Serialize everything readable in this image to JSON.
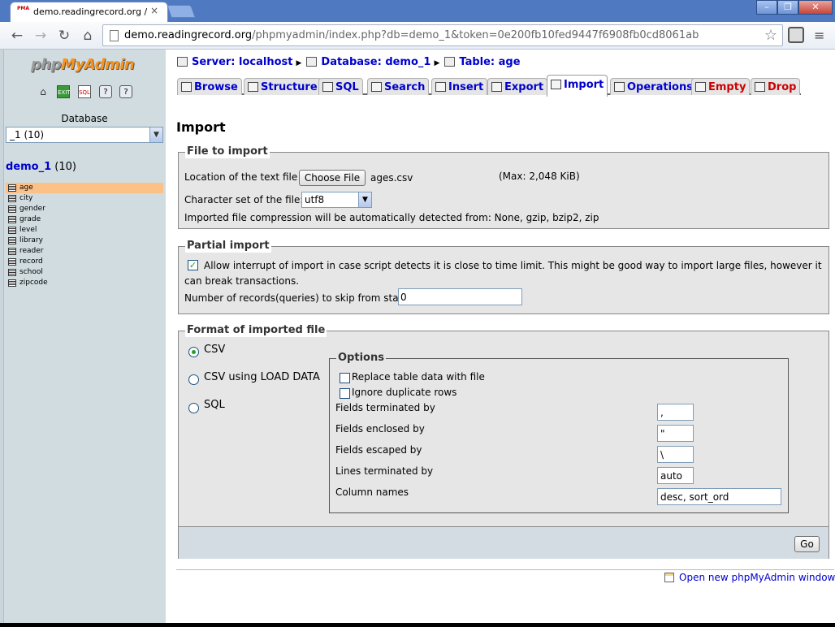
{
  "browser": {
    "tab_title": "demo.readingrecord.org / loc",
    "tab_close": "×",
    "favicon_text": "PMA",
    "url_host": "demo.readingrecord.org",
    "url_path": "/phpmyadmin/index.php?db=demo_1&token=0e200fb10fed9447f6908fb0cd8061ab",
    "window_buttons": {
      "min": "–",
      "max": "❐",
      "close": "✕"
    }
  },
  "sidebar": {
    "logo_php": "php",
    "logo_my": "MyAdmin",
    "db_label": "Database",
    "db_select_value": "_1 (10)",
    "db_name": "demo_1",
    "db_count": "(10)",
    "tables": [
      "age",
      "city",
      "gender",
      "grade",
      "level",
      "library",
      "reader",
      "record",
      "school",
      "zipcode"
    ],
    "selected_table": "age",
    "icons": [
      "home-icon",
      "exit-icon",
      "sql-query-icon",
      "docs-icon",
      "query-window-icon"
    ]
  },
  "breadcrumb": {
    "server": "Server: localhost",
    "database": "Database: demo_1",
    "table": "Table: age"
  },
  "tabs": {
    "browse": "Browse",
    "structure": "Structure",
    "sql": "SQL",
    "search": "Search",
    "insert": "Insert",
    "export": "Export",
    "import": "Import",
    "operations": "Operations",
    "empty": "Empty",
    "drop": "Drop",
    "active": "Import"
  },
  "page": {
    "heading": "Import"
  },
  "file_to_import": {
    "legend": "File to import",
    "location_label": "Location of the text file",
    "choose_file_label": "Choose File",
    "file_name": "ages.csv",
    "max_size": "(Max: 2,048 KiB)",
    "charset_label": "Character set of the file:",
    "charset_value": "utf8",
    "compression_note": "Imported file compression will be automatically detected from: None, gzip, bzip2, zip"
  },
  "partial_import": {
    "legend": "Partial import",
    "interrupt_checked": true,
    "interrupt_text": "Allow interrupt of import in case script detects it is close to time limit. This might be good way to import large files, however it can break transactions.",
    "skip_label": "Number of records(queries) to skip from start",
    "skip_value": "0"
  },
  "format": {
    "legend": "Format of imported file",
    "options_list": [
      "CSV",
      "CSV using LOAD DATA",
      "SQL"
    ],
    "selected": "CSV",
    "options": {
      "legend": "Options",
      "replace_label": "Replace table data with file",
      "ignore_label": "Ignore duplicate rows",
      "fields_terminated_label": "Fields terminated by",
      "fields_terminated_value": ",",
      "fields_enclosed_label": "Fields enclosed by",
      "fields_enclosed_value": "\"",
      "fields_escaped_label": "Fields escaped by",
      "fields_escaped_value": "\\",
      "lines_terminated_label": "Lines terminated by",
      "lines_terminated_value": "auto",
      "column_names_label": "Column names",
      "column_names_value": "desc, sort_ord"
    }
  },
  "go_label": "Go",
  "new_window_link": "Open new phpMyAdmin window"
}
